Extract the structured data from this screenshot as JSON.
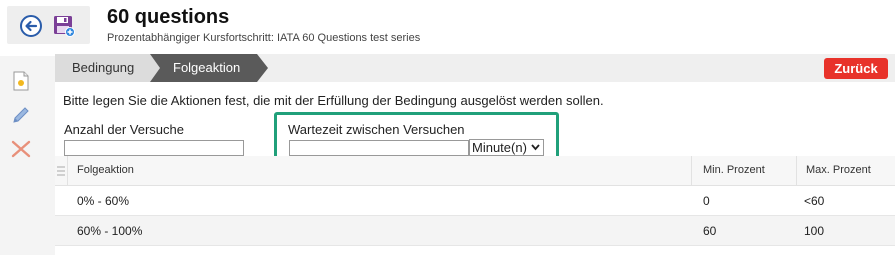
{
  "header": {
    "title": "60 questions",
    "subtitle": "Prozentabhängiger Kursfortschritt: IATA 60 Questions test series",
    "back_icon": "back-arrow-circle-icon",
    "save_icon": "floppy-save-icon"
  },
  "left_rail": {
    "icons": [
      "new-document-icon",
      "pencil-edit-icon",
      "delete-x-icon"
    ]
  },
  "breadcrumb": {
    "steps": [
      {
        "label": "Bedingung",
        "active": false
      },
      {
        "label": "Folgeaktion",
        "active": true
      }
    ],
    "back_button_label": "Zurück"
  },
  "colors": {
    "accent_red": "#e8322a",
    "active_crumb": "#5a5a5a",
    "highlight_green": "#20a07a"
  },
  "instruction": "Bitte legen Sie die Aktionen fest, die mit der Erfüllung der Bedingung ausgelöst werden sollen.",
  "form": {
    "attempts_label": "Anzahl der Versuche",
    "attempts_value": "",
    "wait_label": "Wartezeit zwischen Versuchen",
    "wait_value": "",
    "wait_unit": "Minute(n)"
  },
  "table": {
    "columns": [
      "Folgeaktion",
      "Min. Prozent",
      "Max. Prozent"
    ],
    "rows": [
      {
        "action": "0% - 60%",
        "min": "0",
        "max": "<60"
      },
      {
        "action": "60% - 100%",
        "min": "60",
        "max": "100"
      }
    ]
  }
}
